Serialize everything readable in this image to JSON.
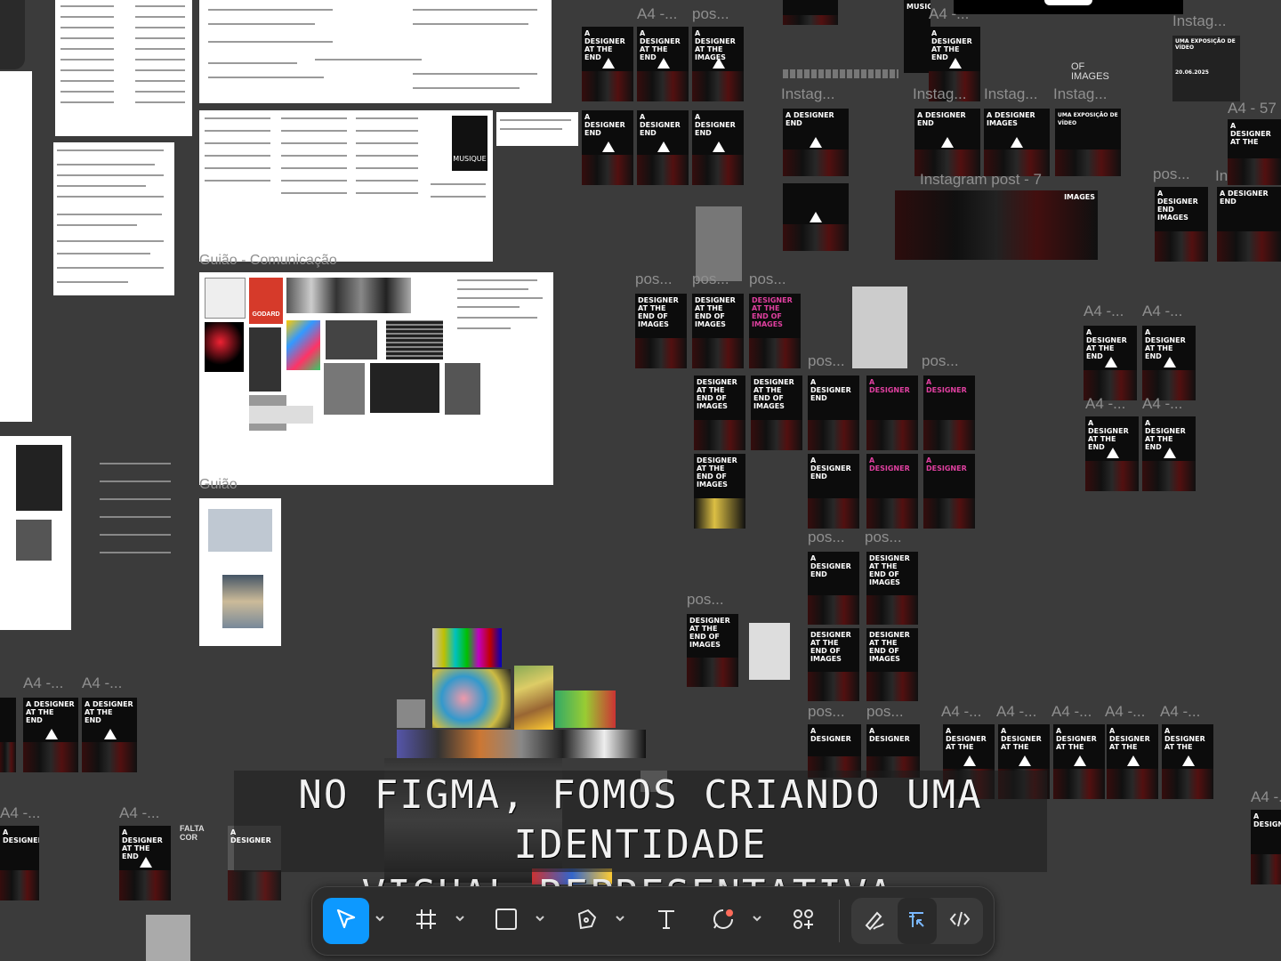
{
  "caption": {
    "line1": "NO FIGMA, FOMOS CRIANDO UMA IDENTIDADE",
    "line2": "VISUAL REPRESENTATIVA."
  },
  "canvas": {
    "frame_labels": {
      "a4_trunc": "A4 -...",
      "a4_57_trunc": "A4 - 57",
      "pos_trunc": "pos...",
      "instag_trunc": "Instag...",
      "instagram_post_7": "Instagram post - 7",
      "instagram_trunc": "Instagram",
      "guiao": "Guião",
      "guiao_comunicacao": "Guião - Comunicação",
      "of_images": "OF IMAGES",
      "falta_cor": "FALTA COR"
    },
    "poster_text": {
      "a_designer": "A DESIGNER",
      "at_the": "AT THE",
      "end": "END",
      "of": "OF",
      "images": "IMAGES",
      "designer_at_the_end_of_images": "DESIGNER AT THE END OF IMAGES"
    },
    "musique_label": "MUSIQUE",
    "expo_text": "UMA EXPOSIÇÃO DE VÍDEO",
    "expo_date": "20.06.2025",
    "mood_label": "GODARD"
  },
  "toolbar": {
    "tools": [
      {
        "name": "move-tool",
        "icon": "cursor-arrow-icon",
        "active": true
      },
      {
        "name": "frame-tool",
        "icon": "hash-frame-icon"
      },
      {
        "name": "rectangle-tool",
        "icon": "square-shape-icon"
      },
      {
        "name": "pen-tool",
        "icon": "pen-nib-icon"
      },
      {
        "name": "text-tool",
        "icon": "text-t-icon"
      },
      {
        "name": "comment-tool",
        "icon": "comment-bubble-icon"
      },
      {
        "name": "actions-tool",
        "icon": "actions-grid-icon"
      }
    ],
    "right_tools": [
      {
        "name": "draw-mode",
        "icon": "draw-pen-icon"
      },
      {
        "name": "design-mode",
        "icon": "design-layout-icon",
        "active": true
      },
      {
        "name": "dev-mode",
        "icon": "code-brackets-icon"
      }
    ],
    "accent_color": "#0d99ff",
    "comment_dot_color": "#ff6b5a"
  }
}
